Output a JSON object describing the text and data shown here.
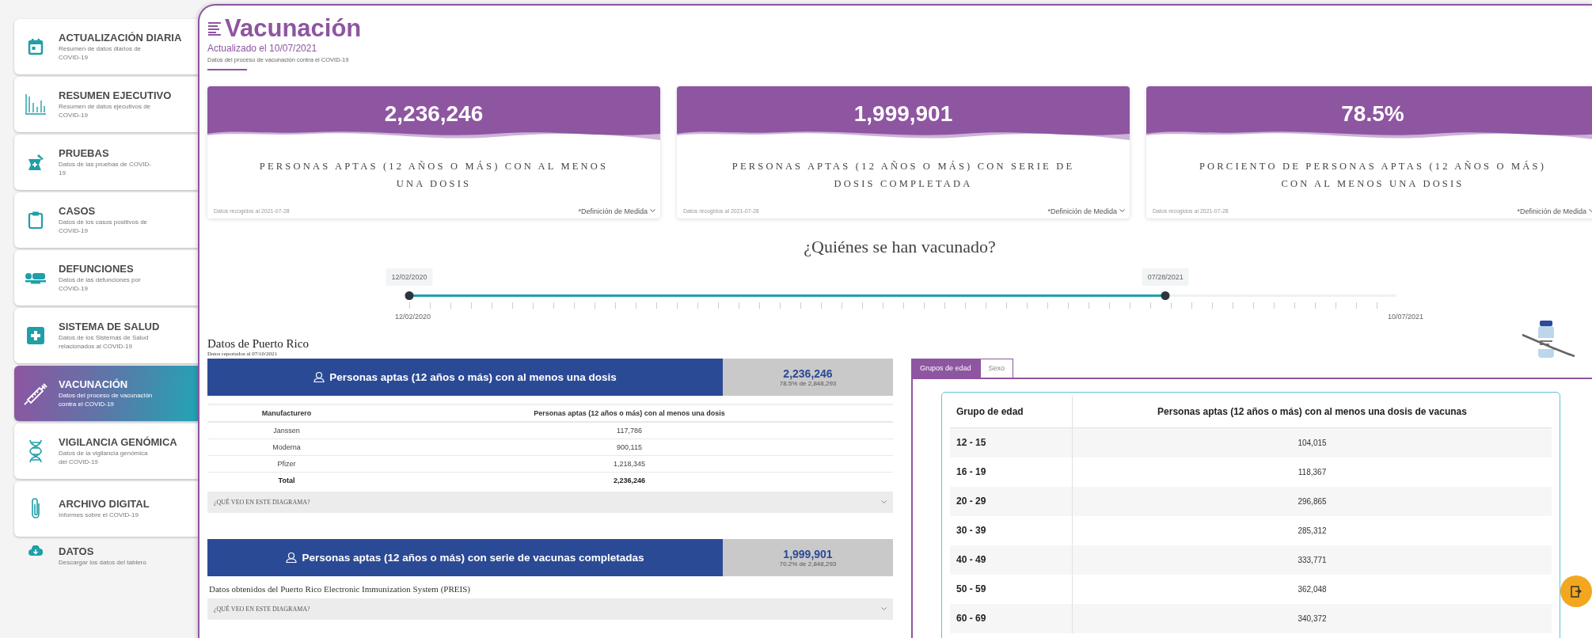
{
  "sidebar": {
    "items": [
      {
        "kind": "card",
        "title": "ACTUALIZACIÓN DIARIA",
        "subtitle": "Resumen de datos diarios de COVID-19",
        "selected": false
      },
      {
        "kind": "card",
        "title": "RESUMEN EJECUTIVO",
        "subtitle": "Resumen de datos ejecutivos de COVID-19",
        "selected": false
      },
      {
        "kind": "card",
        "title": "PRUEBAS",
        "subtitle": "Datos de las pruebas de COVID-19",
        "selected": false
      },
      {
        "kind": "card",
        "title": "CASOS",
        "subtitle": "Datos de los casos positivos de COVID-19",
        "selected": false
      },
      {
        "kind": "card",
        "title": "DEFUNCIONES",
        "subtitle": "Datos de las defunciones por COVID-19",
        "selected": false
      },
      {
        "kind": "card",
        "title": "SISTEMA DE SALUD",
        "subtitle": "Datos de los Sistemas de Salud relacionados al COVID-19",
        "selected": false
      },
      {
        "kind": "card",
        "title": "VACUNACIÓN",
        "subtitle": "Datos del proceso de vacunación contra el COVID-19",
        "selected": true
      },
      {
        "kind": "card",
        "title": "VIGILANCIA GENÓMICA",
        "subtitle": "Datos de la vigilancia genómica del COVID-19",
        "selected": false
      },
      {
        "kind": "card",
        "title": "ARCHIVO DIGITAL",
        "subtitle": "Informes sobre el COVID-19",
        "selected": false
      },
      {
        "kind": "link",
        "title": "DATOS",
        "subtitle": "Descargar los datos del tablero",
        "selected": false
      }
    ]
  },
  "header": {
    "title": "Vacunación",
    "updated": "Actualizado el 10/07/2021",
    "description": "Datos del proceso de vacunación contra el COVID-19"
  },
  "stat_cards": [
    {
      "value": "2,236,246",
      "label": "PERSONAS APTAS (12 AÑOS O MÁS) CON AL MENOS UNA DOSIS",
      "collected": "Datos recogidos al 2021-07-28",
      "definition": "*Definición de Medida"
    },
    {
      "value": "1,999,901",
      "label": "PERSONAS APTAS (12 AÑOS O MÁS) CON SERIE DE DOSIS COMPLETADA",
      "collected": "Datos recogidos al 2021-07-28",
      "definition": "*Definición de Medida"
    },
    {
      "value": "78.5%",
      "label": "PORCIENTO DE PERSONAS APTAS (12 AÑOS O MÁS) CON AL MENOS UNA DOSIS",
      "collected": "Datos recogidos al 2021-07-28",
      "definition": "*Definición de Medida"
    }
  ],
  "timeline": {
    "heading": "¿Quiénes se han vacunado?",
    "start_chip": "12/02/2020",
    "end_chip": "07/28/2021",
    "start_label": "12/02/2020",
    "end_label": "10/07/2021",
    "level": 0.766
  },
  "region": {
    "title": "Datos de Puerto Rico",
    "subtitle": "Datos reportados al 07/10/2021"
  },
  "summaries": [
    {
      "title": "Personas aptas (12 años o más) con al menos una dosis",
      "value": "2,236,246",
      "share": "78.5% de 2,848,293",
      "table": {
        "columns": [
          "Manufacturero",
          "Personas aptas (12 años o más) con al menos una dosis"
        ],
        "rows": [
          [
            "Janssen",
            "117,786"
          ],
          [
            "Moderna",
            "900,115"
          ],
          [
            "Pfizer",
            "1,218,345"
          ]
        ],
        "total": [
          "Total",
          "2,236,246"
        ]
      },
      "accordion": "¿QUÉ VEO EN ESTE DIAGRAMA?"
    },
    {
      "title": "Personas aptas (12 años o más) con serie de vacunas completadas",
      "value": "1,999,901",
      "share": "70.2% de 2,848,293",
      "note": "Datos obtenidos del Puerto Rico Electronic Immunization System (PREIS)",
      "accordion": "¿QUÉ VEO EN ESTE DIAGRAMA?"
    }
  ],
  "breakdown": {
    "tabs": [
      {
        "label": "Grupos de edad",
        "selected": true
      },
      {
        "label": "Sexo",
        "selected": false
      }
    ],
    "columns": [
      "Grupo de edad",
      "Personas aptas (12 años o más) con al menos una dosis de vacunas"
    ],
    "rows": [
      [
        "12 - 15",
        "104,015"
      ],
      [
        "16 - 19",
        "118,367"
      ],
      [
        "20 - 29",
        "296,865"
      ],
      [
        "30 - 39",
        "285,312"
      ],
      [
        "40 - 49",
        "333,771"
      ],
      [
        "50 - 59",
        "362,048"
      ],
      [
        "60 - 69",
        "340,372"
      ]
    ]
  }
}
